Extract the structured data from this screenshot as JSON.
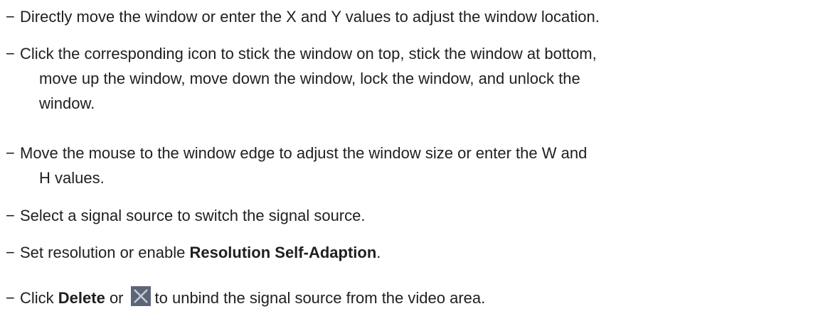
{
  "bullet": "−",
  "items": [
    {
      "lines": [
        "Directly move the window or enter the X and Y values to adjust the window location."
      ]
    },
    {
      "lines": [
        "Click the corresponding icon to stick the window on top, stick the window at bottom,",
        "move up the window, move down the window, lock the window, and unlock the",
        "window."
      ]
    },
    {
      "lines": [
        "Move the mouse to the window edge to adjust the window size or enter the W and",
        "H values."
      ]
    },
    {
      "lines": [
        "Select a signal source to switch the signal source."
      ]
    },
    {
      "pre": "Set resolution or enable ",
      "bold": "Resolution Self-Adaption",
      "post": "."
    },
    {
      "pre": "Click ",
      "bold": "Delete",
      "mid": " or",
      "icon": "close-x-icon",
      "post": "to unbind the signal source from the video area."
    }
  ],
  "colors": {
    "text": "#1f1f1f",
    "icon_bg": "#5c6478",
    "icon_x": "#c8cbd2"
  }
}
